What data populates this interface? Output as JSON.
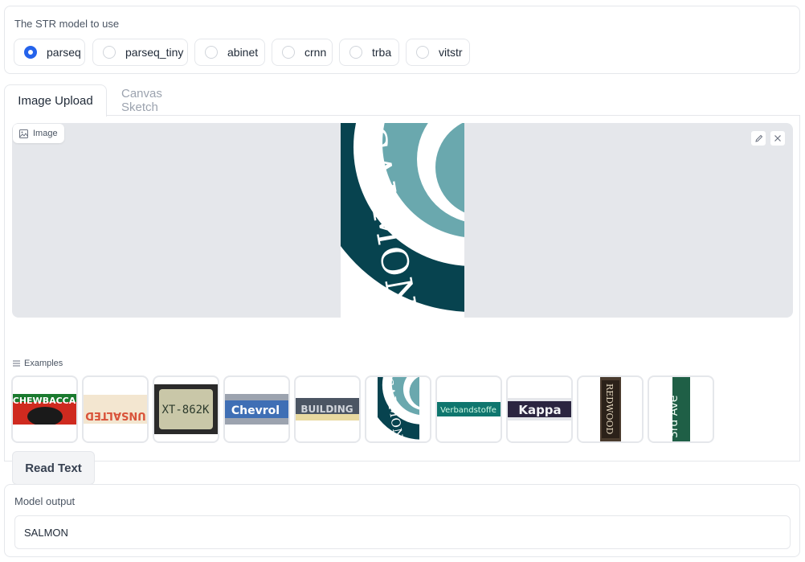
{
  "model_selector": {
    "label": "The STR model to use",
    "selected": "parseq",
    "options": [
      "parseq",
      "parseq_tiny",
      "abinet",
      "crnn",
      "trba",
      "vitstr"
    ]
  },
  "tabs": [
    {
      "label": "Image Upload",
      "active": true
    },
    {
      "label": "Canvas Sketch",
      "active": false
    }
  ],
  "image_input": {
    "chip_label": "Image",
    "chip_icon": "image-icon",
    "edit_icon": "pencil-icon",
    "clear_icon": "close-icon",
    "current_image_text": "SALMON"
  },
  "examples": {
    "label": "Examples",
    "icon": "list-icon",
    "items": [
      "CHEWBACCA",
      "UNSALTED",
      "XT-862K",
      "Chevrol",
      "BUILDING",
      "SALMON",
      "Verbandstoffe",
      "Kappa",
      "REDWOOD",
      "3rd Ave"
    ]
  },
  "actions": {
    "read_text_label": "Read Text"
  },
  "output": {
    "label": "Model output",
    "value": "SALMON"
  },
  "colors": {
    "accent": "#2563eb",
    "salmon_teal": "#07434f",
    "salmon_light": "#6aa8ae"
  }
}
